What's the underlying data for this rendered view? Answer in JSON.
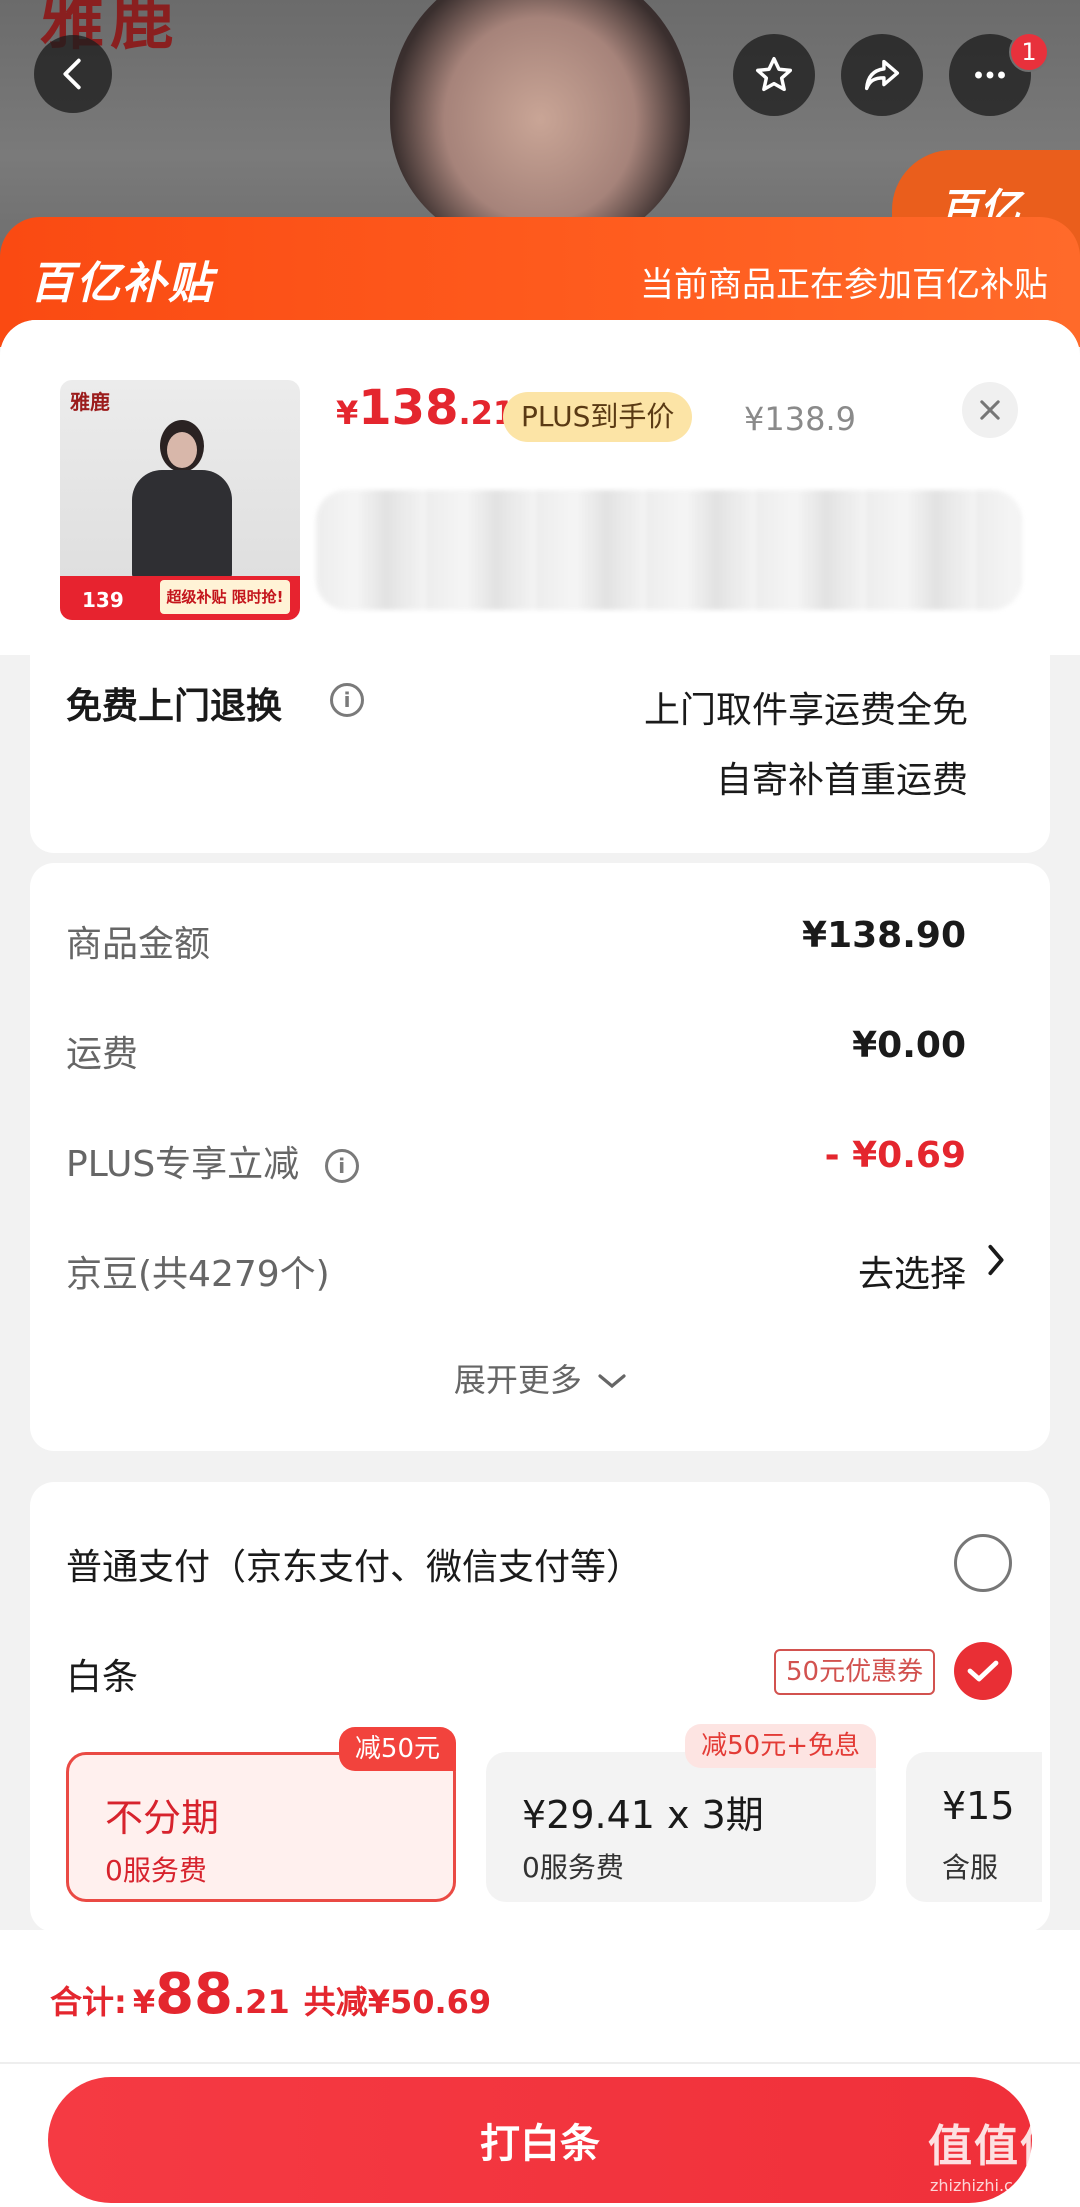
{
  "hero": {
    "brand": "雅鹿",
    "badge_text": "百亿"
  },
  "nav": {
    "back_icon": "chevron-left-icon",
    "favorite_icon": "star-icon",
    "share_icon": "share-icon",
    "more_icon": "more-dots-icon",
    "notification_count": "1"
  },
  "subsidy": {
    "logo": "百亿补贴",
    "note": "当前商品正在参加百亿补贴"
  },
  "product": {
    "thumb_brand": "雅鹿",
    "thumb_price": "139",
    "thumb_tag": "超级补贴 限时抢!",
    "price_currency": "¥",
    "price_integer": "138",
    "price_decimal": ".21",
    "plus_tag": "PLUS到手价",
    "original_price": "¥138.9"
  },
  "return_service": {
    "title": "免费上门退换",
    "line1": "上门取件享运费全免",
    "line2": "自寄补首重运费"
  },
  "summary": {
    "rows": [
      {
        "label": "商品金额",
        "value": "¥138.90"
      },
      {
        "label": "运费",
        "value": "¥0.00"
      },
      {
        "label": "PLUS专享立减",
        "value": "- ¥0.69"
      },
      {
        "label": "京豆(共4279个)",
        "value": "去选择"
      }
    ],
    "expand_label": "展开更多"
  },
  "payment": {
    "normal_label": "普通支付（京东支付、微信支付等）",
    "baitiao_label": "白条",
    "coupon": "50元优惠券",
    "plans": [
      {
        "main": "不分期",
        "sub": "0服务费",
        "badge": "减50元"
      },
      {
        "main": "¥29.41 x 3期",
        "sub": "0服务费",
        "badge": "减50元+免息"
      },
      {
        "main": "¥15",
        "sub": "含服"
      }
    ]
  },
  "footer": {
    "total_label": "合计:",
    "total_currency": "¥",
    "total_integer": "88",
    "total_decimal": ".21",
    "total_saved": "共减¥50.69",
    "pay_button": "打白条",
    "watermark": "值值值",
    "watermark_sub": "zhizhizhi.com"
  },
  "colors": {
    "accent_red": "#e4262e",
    "subsidy_orange": "#fa4a12",
    "plus_gold": "#fce4a6"
  }
}
